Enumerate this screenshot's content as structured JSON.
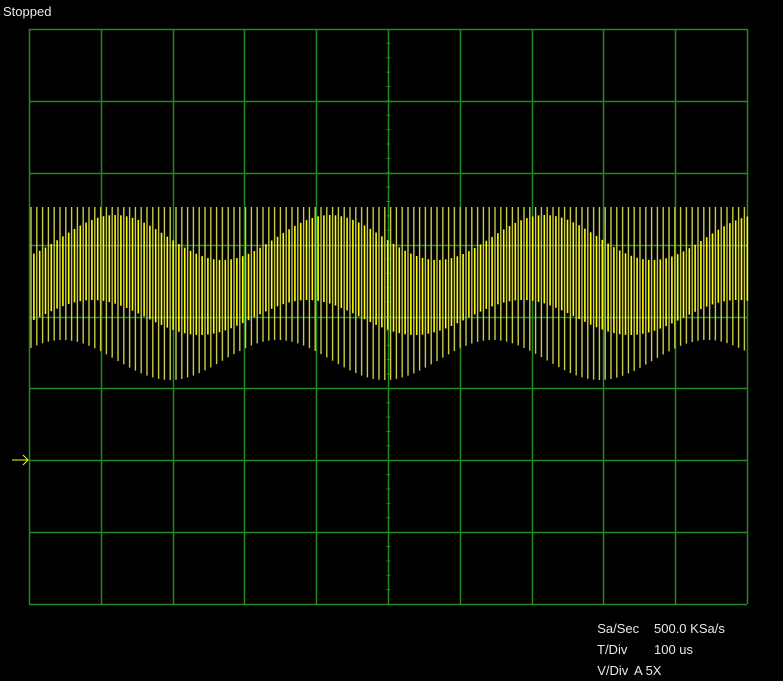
{
  "status": "Stopped",
  "readouts": [
    {
      "label": "Sa/Sec",
      "value": "500.0 KSa/s"
    },
    {
      "label": "T/Div",
      "value": "100 us"
    },
    {
      "label": "V/Div",
      "value": "A 5X"
    }
  ],
  "colors": {
    "grid": "#1e8c1e",
    "trace": "#ffff00",
    "trace_dim": "#c8c84a",
    "marker": "#ffff00",
    "text": "#e8e8e8"
  },
  "grid": {
    "h_divisions": 10,
    "v_divisions": 8
  },
  "ground_marker_icon": "arrow-right-icon"
}
